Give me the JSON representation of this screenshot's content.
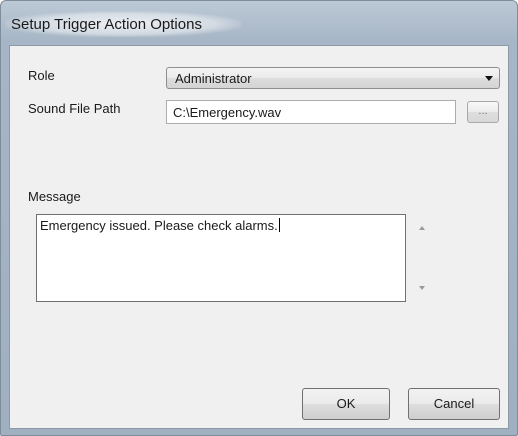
{
  "window": {
    "title": "Setup Trigger Action Options"
  },
  "form": {
    "role_label": "Role",
    "role_value": "Administrator",
    "sound_label": "Sound File Path",
    "sound_value": "C:\\Emergency.wav",
    "browse_label": "...",
    "message_label": "Message",
    "message_value": "Emergency issued. Please check alarms."
  },
  "buttons": {
    "ok": "OK",
    "cancel": "Cancel"
  },
  "icons": {
    "role_dropdown": "chevron-down-icon",
    "scroll_up": "scroll-up-icon",
    "scroll_down": "scroll-down-icon"
  }
}
